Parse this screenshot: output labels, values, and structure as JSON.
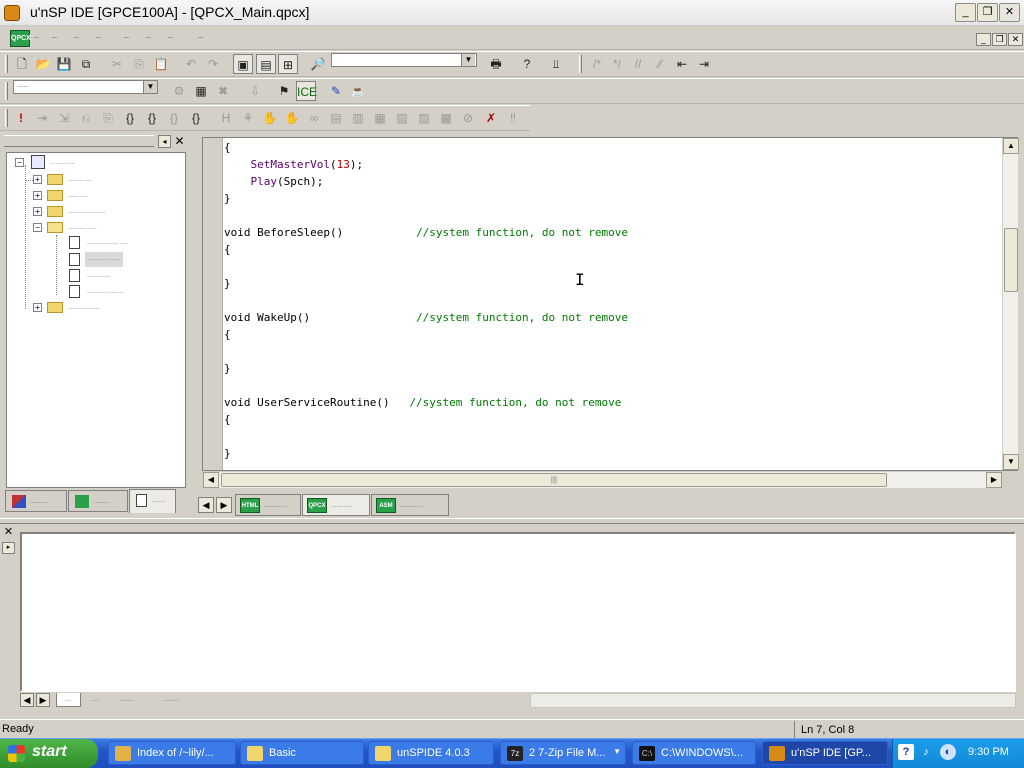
{
  "window": {
    "title": "u'nSP IDE [GPCE100A] - [QPCX_Main.qpcx]",
    "min_label": "_",
    "max_label": "❐",
    "close_label": "✕"
  },
  "menu": {
    "mdi_icon_label": "QPCX",
    "items": [
      "---",
      "---",
      "---",
      "---",
      "---",
      "---",
      "---",
      "---"
    ],
    "mdi_min": "_",
    "mdi_restore": "❐",
    "mdi_close": "✕"
  },
  "toolbar": {
    "combo_configs": "",
    "combo_project": "-------"
  },
  "tree": {
    "root_label": "--- -------- -----",
    "folders": [
      "----------- ------",
      "------- ------",
      "------------ ---------------",
      "------ ------ -------",
      "------------ ----------"
    ],
    "files": [
      "--------------- -------- ------",
      "------- -------- ------",
      "------------ -----",
      "------ ------- -------- -----"
    ]
  },
  "panel_tabs": [
    "-------------",
    "-------------",
    "----------"
  ],
  "code": {
    "lines": [
      {
        "text": "{",
        "kind": "plain"
      },
      {
        "indent": "    ",
        "call": "SetMasterVol",
        "open": "(",
        "num": "13",
        "close": ");",
        "kind": "call_num"
      },
      {
        "indent": "    ",
        "call": "Play",
        "open": "(",
        "arg": "Spch",
        "close": ");",
        "kind": "call_arg"
      },
      {
        "text": "}",
        "kind": "plain"
      },
      {
        "text": "",
        "kind": "plain"
      },
      {
        "decl": "void BeforeSleep()           ",
        "comment": "//system function, do not remove",
        "kind": "decl"
      },
      {
        "text": "{",
        "kind": "plain"
      },
      {
        "text": "",
        "kind": "plain"
      },
      {
        "text": "}",
        "kind": "plain"
      },
      {
        "text": "",
        "kind": "plain"
      },
      {
        "decl": "void WakeUp()                ",
        "comment": "//system function, do not remove",
        "kind": "decl"
      },
      {
        "text": "{",
        "kind": "plain"
      },
      {
        "text": "",
        "kind": "plain"
      },
      {
        "text": "}",
        "kind": "plain"
      },
      {
        "text": "",
        "kind": "plain"
      },
      {
        "decl": "void UserServiceRoutine()   ",
        "comment": "//system function, do not remove",
        "kind": "decl"
      },
      {
        "text": "{",
        "kind": "plain"
      },
      {
        "text": "",
        "kind": "plain"
      },
      {
        "text": "}",
        "kind": "plain"
      }
    ]
  },
  "doc_tabs": [
    {
      "icon": "HTML",
      "label": "------------ ------",
      "color": "#2aa04a"
    },
    {
      "icon": "QPCX",
      "label": "--------- ------",
      "color": "#2aa04a"
    },
    {
      "icon": "ASM",
      "label": "------------ ------",
      "color": "#2aa04a"
    }
  ],
  "output_tabs": [
    "-----",
    "-----",
    "-----------",
    "-----------"
  ],
  "status": {
    "ready": "Ready",
    "position": "Ln 7, Col 8"
  },
  "taskbar": {
    "start_label": "start",
    "tasks": [
      {
        "label": "Index of /~lily/...",
        "icon_color": "#e2b24a"
      },
      {
        "label": "Basic",
        "icon_color": "#f3d66b"
      },
      {
        "label": "unSPIDE 4.0.3",
        "icon_color": "#f3d66b"
      },
      {
        "label": "2 7-Zip File M...",
        "icon_color": "#222222"
      },
      {
        "label": "C:\\WINDOWS\\...",
        "icon_color": "#111111"
      },
      {
        "label": "u'nSP IDE [GP...",
        "icon_color": "#d88a18"
      }
    ],
    "clock": "9:30 PM"
  },
  "colors": {
    "comment": "#007a00",
    "number": "#b00000",
    "taskbar": "#2456c8",
    "start": "#2f8e2a"
  }
}
